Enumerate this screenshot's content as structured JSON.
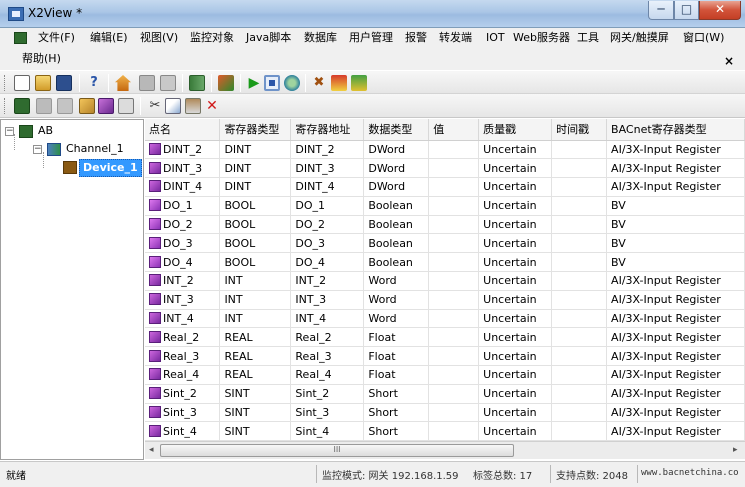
{
  "window": {
    "title": "X2View *",
    "min_glyph": "─",
    "max_glyph": "□",
    "close_glyph": "✕"
  },
  "menu": [
    "文件(F)",
    "编辑(E)",
    "视图(V)",
    "监控对象",
    "Java脚本",
    "数据库",
    "用户管理",
    "报警",
    "转发端",
    "IOT",
    "Web服务器",
    "工具",
    "网关/触摸屏",
    "窗口(W)",
    "帮助(H)"
  ],
  "mdi_close": "×",
  "tree": {
    "root": "AB",
    "channel": "Channel_1",
    "device": "Device_1",
    "expand_glyph": "−"
  },
  "table": {
    "columns": [
      "点名",
      "寄存器类型",
      "寄存器地址",
      "数据类型",
      "值",
      "质量戳",
      "时间戳",
      "BACnet寄存器类型"
    ],
    "rows": [
      [
        "DINT_2",
        "DINT",
        "DINT_2",
        "DWord",
        "",
        "Uncertain",
        "",
        "AI/3X-Input Register"
      ],
      [
        "DINT_3",
        "DINT",
        "DINT_3",
        "DWord",
        "",
        "Uncertain",
        "",
        "AI/3X-Input Register"
      ],
      [
        "DINT_4",
        "DINT",
        "DINT_4",
        "DWord",
        "",
        "Uncertain",
        "",
        "AI/3X-Input Register"
      ],
      [
        "DO_1",
        "BOOL",
        "DO_1",
        "Boolean",
        "",
        "Uncertain",
        "",
        "BV"
      ],
      [
        "DO_2",
        "BOOL",
        "DO_2",
        "Boolean",
        "",
        "Uncertain",
        "",
        "BV"
      ],
      [
        "DO_3",
        "BOOL",
        "DO_3",
        "Boolean",
        "",
        "Uncertain",
        "",
        "BV"
      ],
      [
        "DO_4",
        "BOOL",
        "DO_4",
        "Boolean",
        "",
        "Uncertain",
        "",
        "BV"
      ],
      [
        "INT_2",
        "INT",
        "INT_2",
        "Word",
        "",
        "Uncertain",
        "",
        "AI/3X-Input Register"
      ],
      [
        "INT_3",
        "INT",
        "INT_3",
        "Word",
        "",
        "Uncertain",
        "",
        "AI/3X-Input Register"
      ],
      [
        "INT_4",
        "INT",
        "INT_4",
        "Word",
        "",
        "Uncertain",
        "",
        "AI/3X-Input Register"
      ],
      [
        "Real_2",
        "REAL",
        "Real_2",
        "Float",
        "",
        "Uncertain",
        "",
        "AI/3X-Input Register"
      ],
      [
        "Real_3",
        "REAL",
        "Real_3",
        "Float",
        "",
        "Uncertain",
        "",
        "AI/3X-Input Register"
      ],
      [
        "Real_4",
        "REAL",
        "Real_4",
        "Float",
        "",
        "Uncertain",
        "",
        "AI/3X-Input Register"
      ],
      [
        "Sint_2",
        "SINT",
        "Sint_2",
        "Short",
        "",
        "Uncertain",
        "",
        "AI/3X-Input Register"
      ],
      [
        "Sint_3",
        "SINT",
        "Sint_3",
        "Short",
        "",
        "Uncertain",
        "",
        "AI/3X-Input Register"
      ],
      [
        "Sint_4",
        "SINT",
        "Sint_4",
        "Short",
        "",
        "Uncertain",
        "",
        "AI/3X-Input Register"
      ]
    ]
  },
  "scrollbar": {
    "left_glyph": "◂",
    "right_glyph": "▸",
    "thumb_glyph": "III"
  },
  "status": {
    "ready": "就绪",
    "mode": "监控模式: 网关 192.168.1.59",
    "tags": "标签总数: 17",
    "points": "支持点数: 2048",
    "site": "www.bacnetchina.co"
  },
  "icon_names": [
    "new",
    "open",
    "save",
    "help",
    "home",
    "grid",
    "list",
    "export",
    "import",
    "run",
    "stop",
    "refresh",
    "tools",
    "load",
    "download",
    "add-channel",
    "add-device",
    "delete-a",
    "add-tag",
    "add-multi",
    "properties",
    "cut",
    "copy",
    "paste",
    "delete"
  ]
}
